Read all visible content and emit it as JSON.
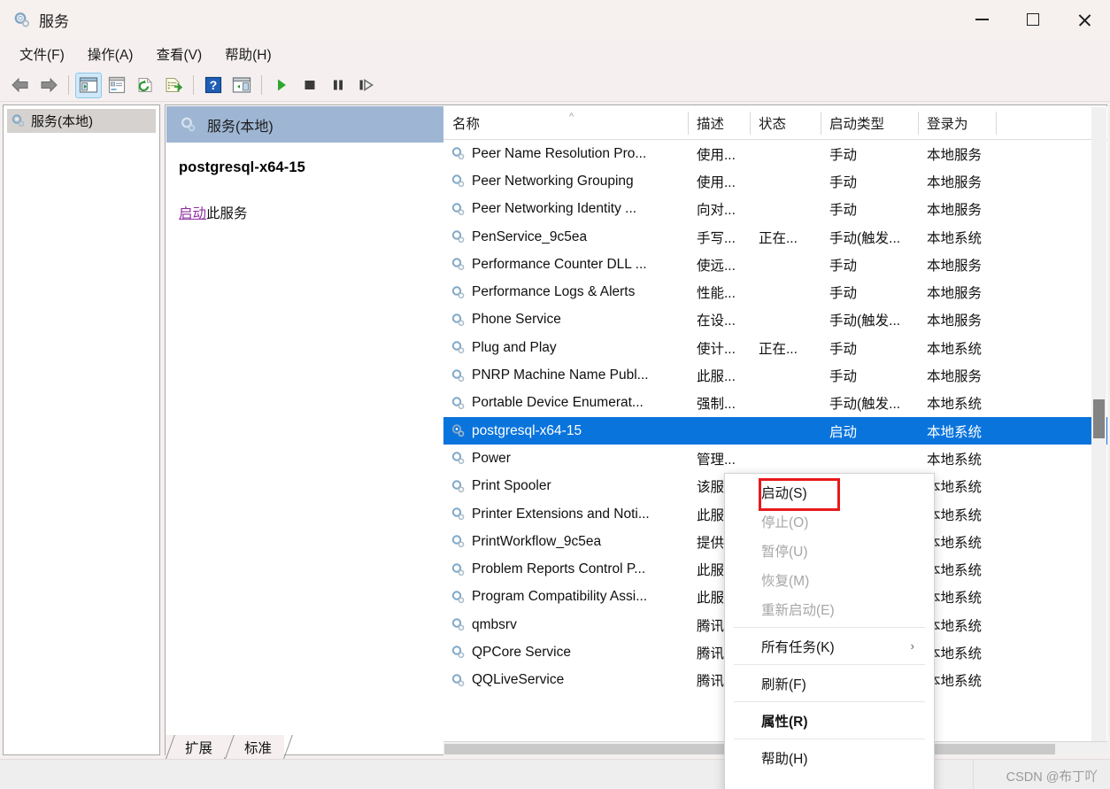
{
  "window": {
    "title": "服务",
    "icon": "services-gear-icon",
    "controls": {
      "minimize": "minimize-icon",
      "maximize": "maximize-icon",
      "close": "close-icon"
    }
  },
  "menubar": {
    "items": [
      {
        "label": "文件(F)",
        "name": "menu-file"
      },
      {
        "label": "操作(A)",
        "name": "menu-action"
      },
      {
        "label": "查看(V)",
        "name": "menu-view"
      },
      {
        "label": "帮助(H)",
        "name": "menu-help"
      }
    ]
  },
  "toolbar": {
    "buttons": [
      {
        "name": "back-arrow-icon",
        "kind": "back"
      },
      {
        "name": "forward-arrow-icon",
        "kind": "forward"
      },
      {
        "name": "separator-1",
        "kind": "sep"
      },
      {
        "name": "show-hide-console-tree-icon",
        "kind": "tree",
        "active": true
      },
      {
        "name": "properties-icon",
        "kind": "properties"
      },
      {
        "name": "refresh-icon",
        "kind": "refresh"
      },
      {
        "name": "export-list-icon",
        "kind": "export"
      },
      {
        "name": "separator-2",
        "kind": "sep"
      },
      {
        "name": "help-icon",
        "kind": "help"
      },
      {
        "name": "show-action-pane-icon",
        "kind": "actionpane"
      },
      {
        "name": "separator-3",
        "kind": "sep"
      },
      {
        "name": "start-service-icon",
        "kind": "start"
      },
      {
        "name": "stop-service-icon",
        "kind": "stop"
      },
      {
        "name": "pause-service-icon",
        "kind": "pause"
      },
      {
        "name": "restart-service-icon",
        "kind": "restart"
      }
    ]
  },
  "tree": {
    "root": {
      "label": "服务(本地)",
      "icon": "services-gear-icon",
      "selected": true
    }
  },
  "banner": {
    "label": "服务(本地)",
    "icon": "services-gear-icon"
  },
  "details": {
    "service_name": "postgresql-x64-15",
    "action_link": "启动",
    "action_suffix": "此服务"
  },
  "list": {
    "columns": [
      {
        "label": "名称",
        "name": "column-header-name",
        "sorted": "asc"
      },
      {
        "label": "描述",
        "name": "column-header-description"
      },
      {
        "label": "状态",
        "name": "column-header-status"
      },
      {
        "label": "启动类型",
        "name": "column-header-startup-type"
      },
      {
        "label": "登录为",
        "name": "column-header-log-on-as"
      }
    ],
    "sort_indicator": "^",
    "rows": [
      {
        "name": "Peer Name Resolution Pro...",
        "desc": "使用...",
        "state": "",
        "start": "手动",
        "logon": "本地服务",
        "selected": false
      },
      {
        "name": "Peer Networking Grouping",
        "desc": "使用...",
        "state": "",
        "start": "手动",
        "logon": "本地服务",
        "selected": false
      },
      {
        "name": "Peer Networking Identity ...",
        "desc": "向对...",
        "state": "",
        "start": "手动",
        "logon": "本地服务",
        "selected": false
      },
      {
        "name": "PenService_9c5ea",
        "desc": "手写...",
        "state": "正在...",
        "start": "手动(触发...",
        "logon": "本地系统",
        "selected": false
      },
      {
        "name": "Performance Counter DLL ...",
        "desc": "使远...",
        "state": "",
        "start": "手动",
        "logon": "本地服务",
        "selected": false
      },
      {
        "name": "Performance Logs & Alerts",
        "desc": "性能...",
        "state": "",
        "start": "手动",
        "logon": "本地服务",
        "selected": false
      },
      {
        "name": "Phone Service",
        "desc": "在设...",
        "state": "",
        "start": "手动(触发...",
        "logon": "本地服务",
        "selected": false
      },
      {
        "name": "Plug and Play",
        "desc": "使计...",
        "state": "正在...",
        "start": "手动",
        "logon": "本地系统",
        "selected": false
      },
      {
        "name": "PNRP Machine Name Publ...",
        "desc": "此服...",
        "state": "",
        "start": "手动",
        "logon": "本地服务",
        "selected": false
      },
      {
        "name": "Portable Device Enumerat...",
        "desc": "强制...",
        "state": "",
        "start": "手动(触发...",
        "logon": "本地系统",
        "selected": false
      },
      {
        "name": "postgresql-x64-15",
        "desc": "",
        "state": "",
        "start": "启动",
        "logon": "本地系统",
        "selected": true
      },
      {
        "name": "Power",
        "desc": "管理...",
        "state": "",
        "start": "",
        "logon": "本地系统",
        "selected": false
      },
      {
        "name": "Print Spooler",
        "desc": "该服...",
        "state": "",
        "start": "",
        "logon": "本地系统",
        "selected": false
      },
      {
        "name": "Printer Extensions and Noti...",
        "desc": "此服...",
        "state": "",
        "start": "",
        "logon": "本地系统",
        "selected": false
      },
      {
        "name": "PrintWorkflow_9c5ea",
        "desc": "提供...",
        "state": "",
        "start": "",
        "logon": "本地系统",
        "selected": false
      },
      {
        "name": "Problem Reports Control P...",
        "desc": "此服...",
        "state": "",
        "start": "",
        "logon": "本地系统",
        "selected": false
      },
      {
        "name": "Program Compatibility Assi...",
        "desc": "此服...",
        "state": "",
        "start": "",
        "logon": "本地系统",
        "selected": false
      },
      {
        "name": "qmbsrv",
        "desc": "腾讯...",
        "state": "",
        "start": "",
        "logon": "本地系统",
        "selected": false
      },
      {
        "name": "QPCore Service",
        "desc": "腾讯...",
        "state": "",
        "start": "",
        "logon": "本地系统",
        "selected": false
      },
      {
        "name": "QQLiveService",
        "desc": "腾讯...",
        "state": "",
        "start": "",
        "logon": "本地系统",
        "selected": false
      }
    ]
  },
  "context_menu": {
    "items": [
      {
        "label": "启动(S)",
        "name": "context-menu-start",
        "disabled": false,
        "bold": false,
        "highlighted": true
      },
      {
        "label": "停止(O)",
        "name": "context-menu-stop",
        "disabled": true,
        "bold": false
      },
      {
        "label": "暂停(U)",
        "name": "context-menu-pause",
        "disabled": true,
        "bold": false
      },
      {
        "label": "恢复(M)",
        "name": "context-menu-resume",
        "disabled": true,
        "bold": false
      },
      {
        "label": "重新启动(E)",
        "name": "context-menu-restart",
        "disabled": true,
        "bold": false
      },
      {
        "type": "separator"
      },
      {
        "label": "所有任务(K)",
        "name": "context-menu-all-tasks",
        "disabled": false,
        "bold": false,
        "submenu": "›"
      },
      {
        "type": "separator"
      },
      {
        "label": "刷新(F)",
        "name": "context-menu-refresh",
        "disabled": false,
        "bold": false
      },
      {
        "type": "separator"
      },
      {
        "label": "属性(R)",
        "name": "context-menu-properties",
        "disabled": false,
        "bold": true
      },
      {
        "type": "separator"
      },
      {
        "label": "帮助(H)",
        "name": "context-menu-help",
        "disabled": false,
        "bold": false
      }
    ]
  },
  "tabs": [
    {
      "label": "扩展",
      "name": "tab-extended",
      "active": false
    },
    {
      "label": "标准",
      "name": "tab-standard",
      "active": true
    }
  ],
  "watermark": "CSDN @布丁吖",
  "colors": {
    "accent_selection": "#0a74dd",
    "banner": "#9eb6d3",
    "link": "#8f2fa0",
    "highlight_box": "#e8191b",
    "window_bg": "#f5f0ef"
  }
}
